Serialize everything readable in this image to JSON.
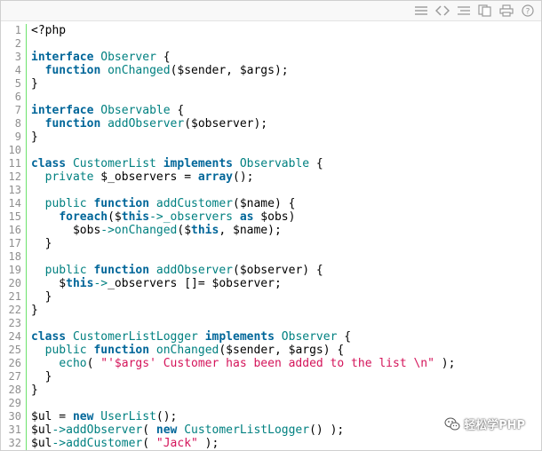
{
  "toolbar": {
    "icons": [
      "view-source-icon",
      "code-brackets-icon",
      "plain-text-icon",
      "copy-icon",
      "print-icon",
      "help-icon"
    ]
  },
  "code": {
    "lines": [
      {
        "n": "1",
        "tokens": [
          {
            "c": "pl",
            "t": "<?php"
          }
        ]
      },
      {
        "n": "2",
        "tokens": []
      },
      {
        "n": "3",
        "tokens": [
          {
            "c": "kw",
            "t": "interface"
          },
          {
            "c": "pl",
            "t": " "
          },
          {
            "c": "fn",
            "t": "Observer"
          },
          {
            "c": "pl",
            "t": " {"
          }
        ]
      },
      {
        "n": "4",
        "tokens": [
          {
            "c": "pl",
            "t": "  "
          },
          {
            "c": "kw",
            "t": "function"
          },
          {
            "c": "pl",
            "t": " "
          },
          {
            "c": "fn",
            "t": "onChanged"
          },
          {
            "c": "pl",
            "t": "($sender, $args);"
          }
        ]
      },
      {
        "n": "5",
        "tokens": [
          {
            "c": "pl",
            "t": "}"
          }
        ]
      },
      {
        "n": "6",
        "tokens": []
      },
      {
        "n": "7",
        "tokens": [
          {
            "c": "kw",
            "t": "interface"
          },
          {
            "c": "pl",
            "t": " "
          },
          {
            "c": "fn",
            "t": "Observable"
          },
          {
            "c": "pl",
            "t": " {"
          }
        ]
      },
      {
        "n": "8",
        "tokens": [
          {
            "c": "pl",
            "t": "  "
          },
          {
            "c": "kw",
            "t": "function"
          },
          {
            "c": "pl",
            "t": " "
          },
          {
            "c": "fn",
            "t": "addObserver"
          },
          {
            "c": "pl",
            "t": "($observer);"
          }
        ]
      },
      {
        "n": "9",
        "tokens": [
          {
            "c": "pl",
            "t": "}"
          }
        ]
      },
      {
        "n": "10",
        "tokens": []
      },
      {
        "n": "11",
        "tokens": [
          {
            "c": "kw",
            "t": "class"
          },
          {
            "c": "pl",
            "t": " "
          },
          {
            "c": "fn",
            "t": "CustomerList"
          },
          {
            "c": "pl",
            "t": " "
          },
          {
            "c": "kw",
            "t": "implements"
          },
          {
            "c": "pl",
            "t": " "
          },
          {
            "c": "fn",
            "t": "Observable"
          },
          {
            "c": "pl",
            "t": " {"
          }
        ]
      },
      {
        "n": "12",
        "tokens": [
          {
            "c": "pl",
            "t": "  "
          },
          {
            "c": "fn",
            "t": "private"
          },
          {
            "c": "pl",
            "t": " $_observers = "
          },
          {
            "c": "kw",
            "t": "array"
          },
          {
            "c": "pl",
            "t": "();"
          }
        ]
      },
      {
        "n": "13",
        "tokens": []
      },
      {
        "n": "14",
        "tokens": [
          {
            "c": "pl",
            "t": "  "
          },
          {
            "c": "fn",
            "t": "public"
          },
          {
            "c": "pl",
            "t": " "
          },
          {
            "c": "kw",
            "t": "function"
          },
          {
            "c": "pl",
            "t": " "
          },
          {
            "c": "fn",
            "t": "addCustomer"
          },
          {
            "c": "pl",
            "t": "($name) {"
          }
        ]
      },
      {
        "n": "15",
        "tokens": [
          {
            "c": "pl",
            "t": "    "
          },
          {
            "c": "kw",
            "t": "foreach"
          },
          {
            "c": "pl",
            "t": "($"
          },
          {
            "c": "kw",
            "t": "this"
          },
          {
            "c": "fn",
            "t": "->_observers"
          },
          {
            "c": "pl",
            "t": " "
          },
          {
            "c": "kw",
            "t": "as"
          },
          {
            "c": "pl",
            "t": " $obs)"
          }
        ]
      },
      {
        "n": "16",
        "tokens": [
          {
            "c": "pl",
            "t": "      $obs"
          },
          {
            "c": "fn",
            "t": "->onChanged"
          },
          {
            "c": "pl",
            "t": "($"
          },
          {
            "c": "kw",
            "t": "this"
          },
          {
            "c": "pl",
            "t": ", $name);"
          }
        ]
      },
      {
        "n": "17",
        "tokens": [
          {
            "c": "pl",
            "t": "  }"
          }
        ]
      },
      {
        "n": "18",
        "tokens": []
      },
      {
        "n": "19",
        "tokens": [
          {
            "c": "pl",
            "t": "  "
          },
          {
            "c": "fn",
            "t": "public"
          },
          {
            "c": "pl",
            "t": " "
          },
          {
            "c": "kw",
            "t": "function"
          },
          {
            "c": "pl",
            "t": " "
          },
          {
            "c": "fn",
            "t": "addObserver"
          },
          {
            "c": "pl",
            "t": "($observer) {"
          }
        ]
      },
      {
        "n": "20",
        "tokens": [
          {
            "c": "pl",
            "t": "    $"
          },
          {
            "c": "kw",
            "t": "this"
          },
          {
            "c": "fn",
            "t": "->"
          },
          {
            "c": "pl",
            "t": "_observers []= $observer;"
          }
        ]
      },
      {
        "n": "21",
        "tokens": [
          {
            "c": "pl",
            "t": "  }"
          }
        ]
      },
      {
        "n": "22",
        "tokens": [
          {
            "c": "pl",
            "t": "}"
          }
        ]
      },
      {
        "n": "23",
        "tokens": []
      },
      {
        "n": "24",
        "tokens": [
          {
            "c": "kw",
            "t": "class"
          },
          {
            "c": "pl",
            "t": " "
          },
          {
            "c": "fn",
            "t": "CustomerListLogger"
          },
          {
            "c": "pl",
            "t": " "
          },
          {
            "c": "kw",
            "t": "implements"
          },
          {
            "c": "pl",
            "t": " "
          },
          {
            "c": "fn",
            "t": "Observer"
          },
          {
            "c": "pl",
            "t": " {"
          }
        ]
      },
      {
        "n": "25",
        "tokens": [
          {
            "c": "pl",
            "t": "  "
          },
          {
            "c": "fn",
            "t": "public"
          },
          {
            "c": "pl",
            "t": " "
          },
          {
            "c": "kw",
            "t": "function"
          },
          {
            "c": "pl",
            "t": " "
          },
          {
            "c": "fn",
            "t": "onChanged"
          },
          {
            "c": "pl",
            "t": "($sender, $args) {"
          }
        ]
      },
      {
        "n": "26",
        "tokens": [
          {
            "c": "pl",
            "t": "    "
          },
          {
            "c": "fn",
            "t": "echo"
          },
          {
            "c": "pl",
            "t": "( "
          },
          {
            "c": "st",
            "t": "\"'$args' Customer has been added to the list \\n\""
          },
          {
            "c": "pl",
            "t": " );"
          }
        ]
      },
      {
        "n": "27",
        "tokens": [
          {
            "c": "pl",
            "t": "  }"
          }
        ]
      },
      {
        "n": "28",
        "tokens": [
          {
            "c": "pl",
            "t": "}"
          }
        ]
      },
      {
        "n": "29",
        "tokens": []
      },
      {
        "n": "30",
        "tokens": [
          {
            "c": "pl",
            "t": "$ul = "
          },
          {
            "c": "kw",
            "t": "new"
          },
          {
            "c": "pl",
            "t": " "
          },
          {
            "c": "fn",
            "t": "UserList"
          },
          {
            "c": "pl",
            "t": "();"
          }
        ]
      },
      {
        "n": "31",
        "tokens": [
          {
            "c": "pl",
            "t": "$ul"
          },
          {
            "c": "fn",
            "t": "->addObserver"
          },
          {
            "c": "pl",
            "t": "( "
          },
          {
            "c": "kw",
            "t": "new"
          },
          {
            "c": "pl",
            "t": " "
          },
          {
            "c": "fn",
            "t": "CustomerListLogger"
          },
          {
            "c": "pl",
            "t": "() );"
          }
        ]
      },
      {
        "n": "32",
        "tokens": [
          {
            "c": "pl",
            "t": "$ul"
          },
          {
            "c": "fn",
            "t": "->addCustomer"
          },
          {
            "c": "pl",
            "t": "( "
          },
          {
            "c": "st",
            "t": "\"Jack\""
          },
          {
            "c": "pl",
            "t": " );"
          }
        ]
      }
    ]
  },
  "watermark": {
    "text": "轻松学PHP",
    "icon": "wechat-logo-icon"
  },
  "colors": {
    "keyword": "#006699",
    "function": "#008080",
    "string": "#d4145a",
    "gutter_line": "#6ce26c",
    "line_number": "#8f8f8f"
  }
}
